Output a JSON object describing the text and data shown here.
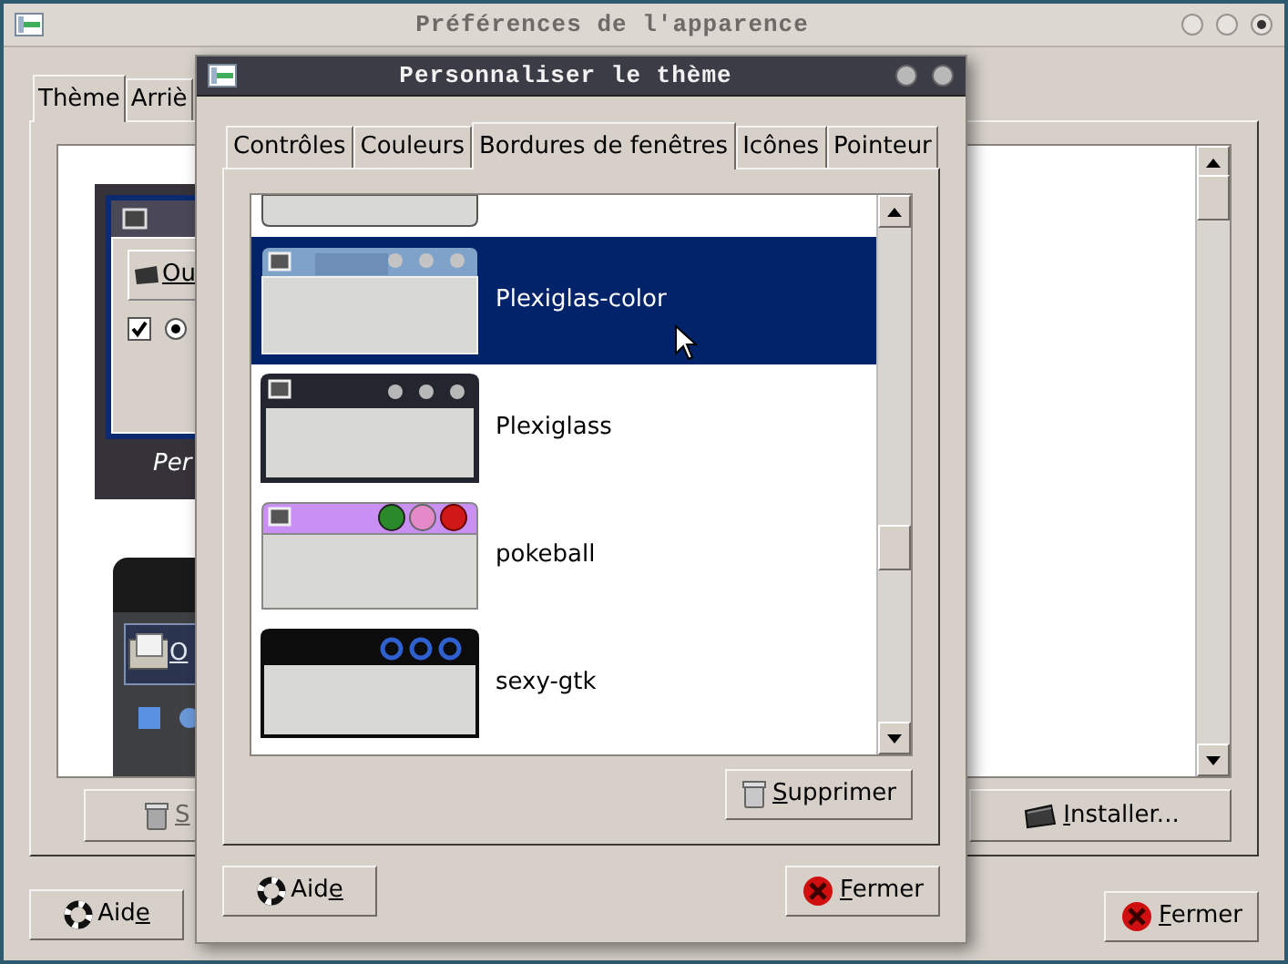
{
  "window": {
    "title": "Préférences de l'apparence"
  },
  "tabs": [
    {
      "label": "Thème",
      "selected": true
    },
    {
      "label": "Arriè",
      "selected": false
    }
  ],
  "theme_previews": [
    {
      "kind": "framed",
      "selected": true,
      "button_text": "Ou",
      "checked": true,
      "caption": "Per"
    },
    {
      "kind": "dark",
      "selected": false,
      "button_text": "O"
    }
  ],
  "theme_buttons": [
    {
      "kind": "delete",
      "label": {
        "key": "S"
      },
      "disabled": true
    },
    {
      "kind": "install",
      "label": {
        "key": "I",
        "after": "nstaller..."
      },
      "disabled": false
    }
  ],
  "buttons": [
    {
      "kind": "help",
      "label": {
        "before": "Aid",
        "key": "e"
      }
    },
    {
      "kind": "close",
      "label": {
        "key": "F",
        "after": "ermer"
      }
    }
  ],
  "dialog": {
    "title": "Personnaliser le thème",
    "tabs": [
      {
        "label": "Contrôles",
        "selected": false
      },
      {
        "label": "Couleurs",
        "selected": false
      },
      {
        "label": "Bordures de fenêtres",
        "selected": true
      },
      {
        "label": "Icônes",
        "selected": false
      },
      {
        "label": "Pointeur",
        "selected": false
      }
    ],
    "themes": [
      {
        "kind": "plain",
        "selected": false
      },
      {
        "kind": "bluebar",
        "name": "Plexiglas-color",
        "selected": true
      },
      {
        "kind": "darkbar",
        "name": "Plexiglass",
        "selected": false
      },
      {
        "kind": "purplebar",
        "name": "pokeball",
        "selected": false
      },
      {
        "kind": "blackbar",
        "name": "sexy-gtk",
        "selected": false
      }
    ],
    "delete_button": {
      "kind": "delete",
      "label": {
        "key": "S",
        "after": "upprimer"
      }
    },
    "buttons": [
      {
        "kind": "help",
        "label": {
          "before": "Aid",
          "key": "e"
        }
      },
      {
        "kind": "close",
        "label": {
          "key": "F",
          "after": "ermer"
        }
      }
    ]
  }
}
